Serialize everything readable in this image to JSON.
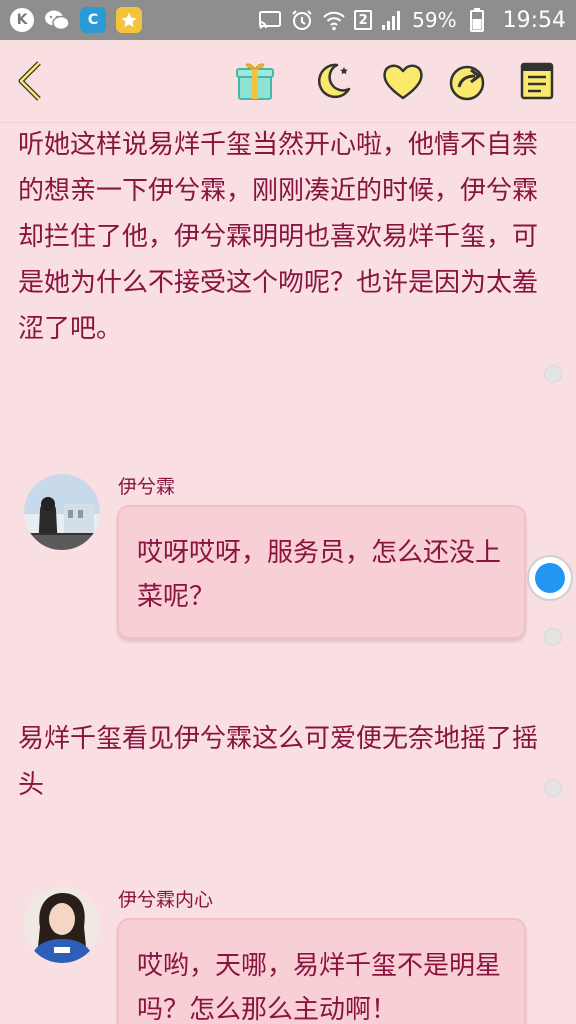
{
  "status_bar": {
    "k_icon": "K",
    "c_icon": "C",
    "battery": "59%",
    "time": "19:54",
    "sim": "2",
    "icons": [
      "k-app-icon",
      "wechat-icon",
      "c-app-icon",
      "star-app-icon",
      "cast-icon",
      "alarm-icon",
      "wifi-icon",
      "sim-icon",
      "signal-icon",
      "battery-icon"
    ]
  },
  "toolbar": {
    "icons": [
      "back-icon",
      "gift-icon",
      "night-mode-icon",
      "heart-icon",
      "share-icon",
      "note-icon"
    ]
  },
  "story": {
    "narration_1": "听她这样说易烊千玺当然开心啦，他情不自禁的想亲一下伊兮霖，刚刚凑近的时候，伊兮霖却拦住了他，伊兮霖明明也喜欢易烊千玺，可是她为什么不接受这个吻呢？也许是因为太羞涩了吧。",
    "message_1": {
      "speaker": "伊兮霖",
      "text": "哎呀哎呀，服务员，怎么还没上菜呢？"
    },
    "narration_2": "易烊千玺看见伊兮霖这么可爱便无奈地摇了摇头",
    "message_2": {
      "speaker": "伊兮霖内心",
      "text": "哎哟，天哪，易烊千玺不是明星吗？怎么那么主动啊！"
    }
  },
  "colors": {
    "background": "#f9dfe2",
    "text": "#8a1440",
    "bubble": "#f7cfd5",
    "status_bar": "#8e8e8e",
    "accent_yellow": "#fbe96b"
  }
}
